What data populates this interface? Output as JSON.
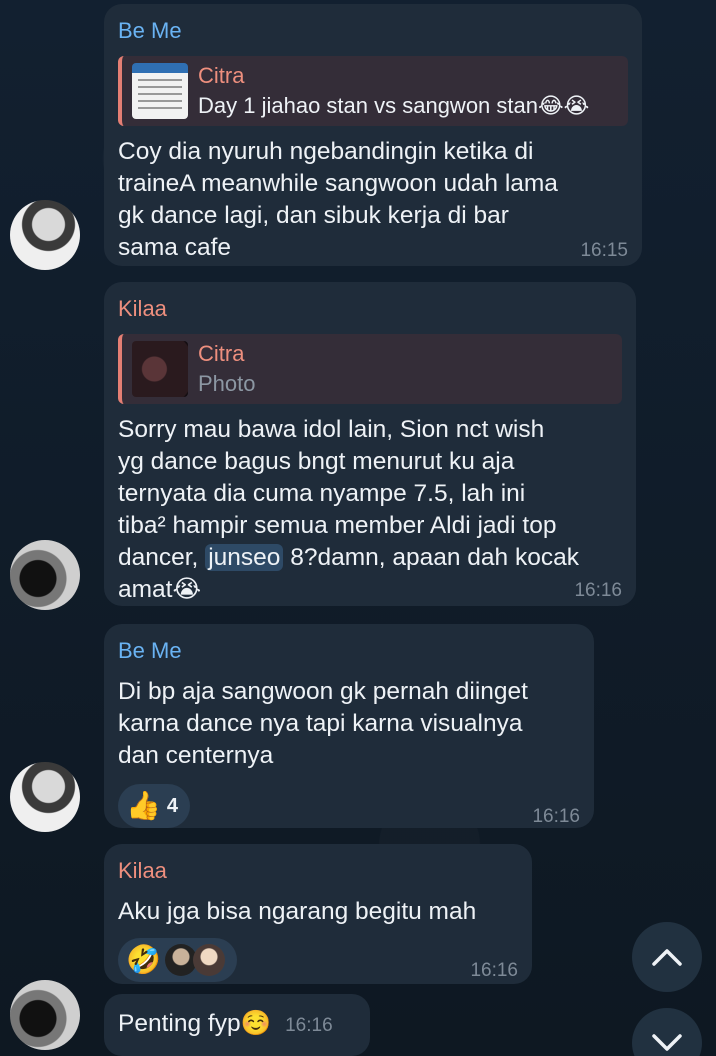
{
  "messages": [
    {
      "sender": "Be Me",
      "reply": {
        "name": "Citra",
        "text": "Day 1 jiahao stan vs sangwon stan😂😭"
      },
      "text": "Coy dia nyuruh ngebandingin ketika di\ntraineA meanwhile sangwoon udah lama\ngk dance lagi, dan sibuk kerja di bar\nsama cafe",
      "time": "16:15"
    },
    {
      "sender": "Kilaa",
      "reply": {
        "name": "Citra",
        "text": "Photo"
      },
      "text_before_mention": "Sorry mau bawa idol lain, Sion nct wish\nyg dance bagus bngt menurut ku aja\nternyata dia cuma nyampe 7.5, lah ini\ntiba² hampir semua member Aldi jadi top\ndancer, ",
      "mention": "junseo",
      "text_after_mention": " 8?damn, apaan dah kocak\namat😭",
      "time": "16:16"
    },
    {
      "sender": "Be Me",
      "text": "Di bp aja sangwoon gk pernah diinget\nkarna dance nya tapi karna visualnya\ndan centernya",
      "reaction": {
        "emoji": "👍",
        "count": "4"
      },
      "time": "16:16"
    },
    {
      "sender": "Kilaa",
      "text": "Aku jga bisa ngarang begitu mah",
      "reaction": {
        "emoji": "🤣"
      },
      "time": "16:16"
    },
    {
      "text": "Penting fyp☺️",
      "time": "16:16"
    }
  ],
  "controls": {
    "scroll_up": "⌃",
    "scroll_down": "⌄"
  },
  "colors": {
    "sender_blue": "#6ab3f3",
    "sender_pink": "#ee8f7e",
    "bubble": "#1f2c3a"
  }
}
